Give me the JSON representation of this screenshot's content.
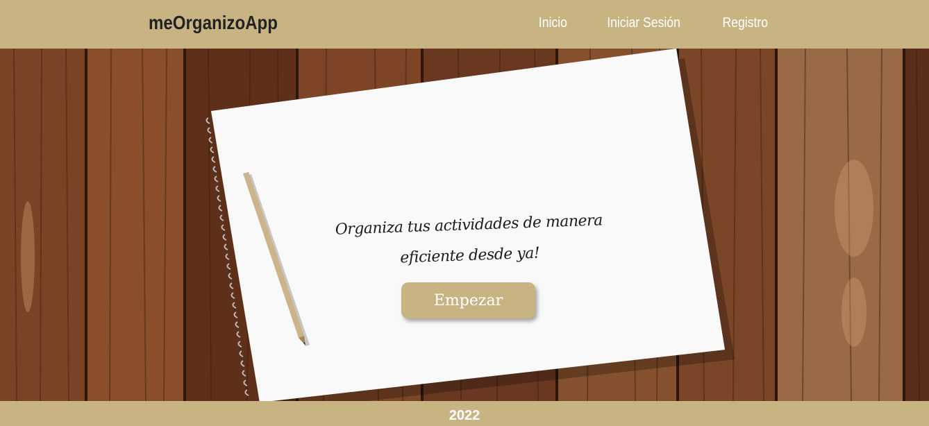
{
  "navbar": {
    "brand": "meOrganizoApp",
    "links": [
      {
        "label": "Inicio"
      },
      {
        "label": "Iniciar Sesión"
      },
      {
        "label": "Registro"
      }
    ]
  },
  "hero": {
    "headline": "Organiza tus actividades de manera eficiente desde ya!",
    "cta_label": "Empezar"
  },
  "footer": {
    "year": "2022"
  },
  "colors": {
    "accent": "#c8b482",
    "text_dark": "#222222",
    "text_light": "#ffffff"
  }
}
